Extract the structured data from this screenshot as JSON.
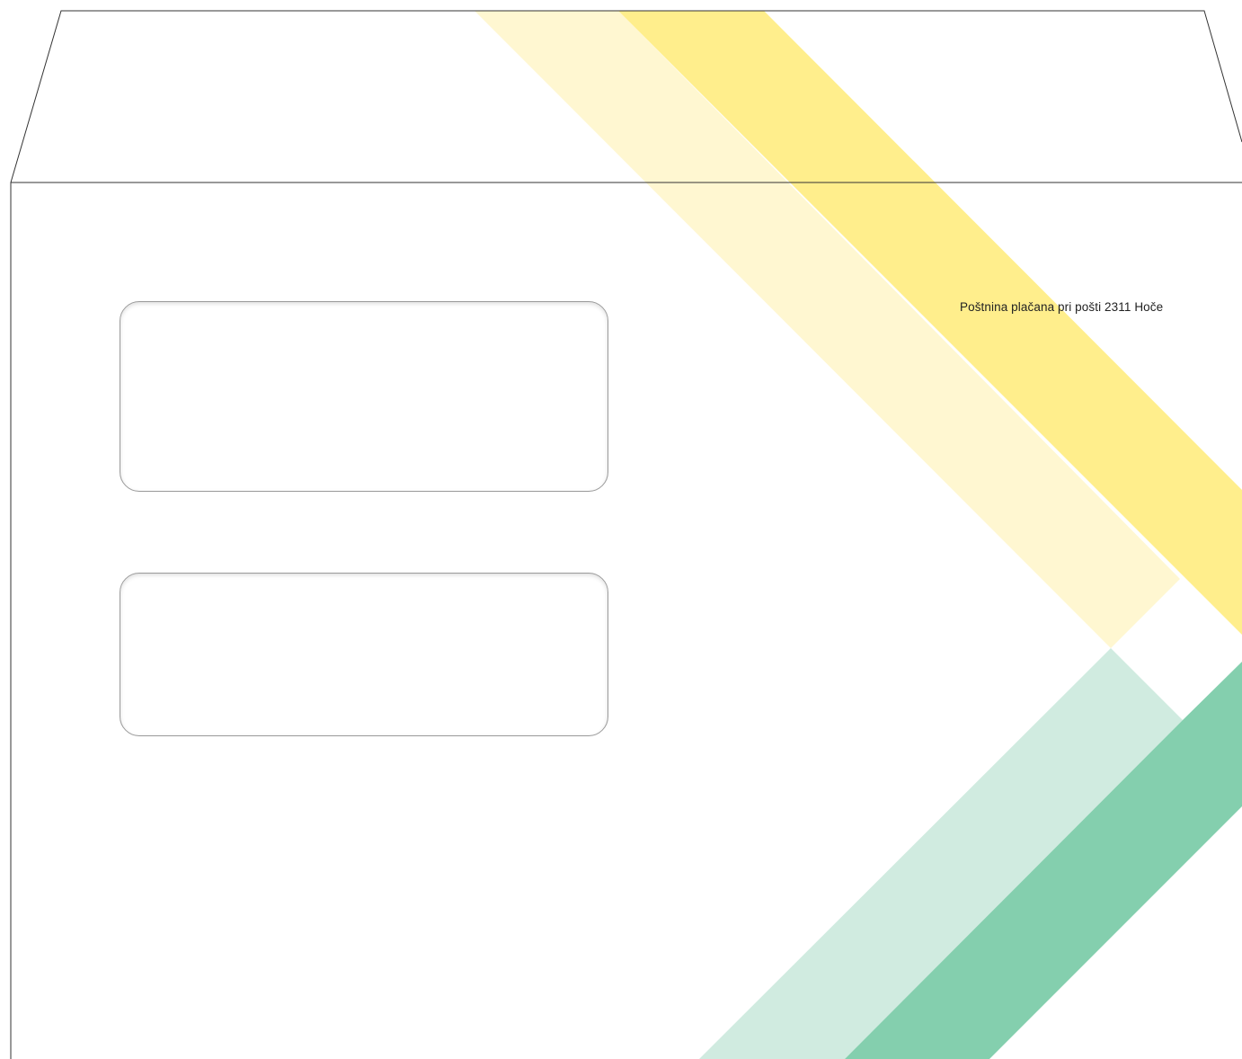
{
  "envelope": {
    "postage_text": "Poštnina plačana pri pošti 2311 Hoče",
    "colors": {
      "yellow_light": "#fff7d1",
      "yellow_strong": "#ffee8c",
      "green_light": "#d0ebe0",
      "green_strong": "#84cfae",
      "outline": "#333333",
      "window_border": "#9a9a9a"
    }
  }
}
